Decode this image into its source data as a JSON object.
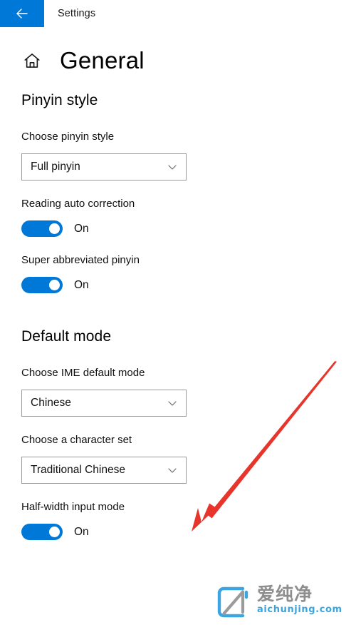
{
  "titlebar": {
    "back_icon": "back-arrow-icon",
    "title": "Settings",
    "accent_color": "#0078d7"
  },
  "header": {
    "home_icon": "home-icon",
    "title": "General"
  },
  "sections": [
    {
      "heading": "Pinyin style",
      "fields": [
        {
          "type": "dropdown",
          "label": "Choose pinyin style",
          "value": "Full pinyin",
          "chevron_icon": "chevron-down-icon"
        },
        {
          "type": "toggle",
          "label": "Reading auto correction",
          "state": "On",
          "checked": true
        },
        {
          "type": "toggle",
          "label": "Super abbreviated pinyin",
          "state": "On",
          "checked": true
        }
      ]
    },
    {
      "heading": "Default mode",
      "fields": [
        {
          "type": "dropdown",
          "label": "Choose IME default mode",
          "value": "Chinese",
          "chevron_icon": "chevron-down-icon"
        },
        {
          "type": "dropdown",
          "label": "Choose a character set",
          "value": "Traditional Chinese",
          "chevron_icon": "chevron-down-icon"
        },
        {
          "type": "toggle",
          "label": "Half-width input mode",
          "state": "On",
          "checked": true
        }
      ]
    }
  ],
  "annotation": {
    "arrow_icon": "red-arrow-icon",
    "color": "#e8352c"
  },
  "watermark": {
    "logo_icon": "aichunjing-logo-icon",
    "brand_cn": "爱纯净",
    "url": "aichunjing.com",
    "logo_color": "#3aa5e0",
    "text_color": "#8e8e8e"
  }
}
